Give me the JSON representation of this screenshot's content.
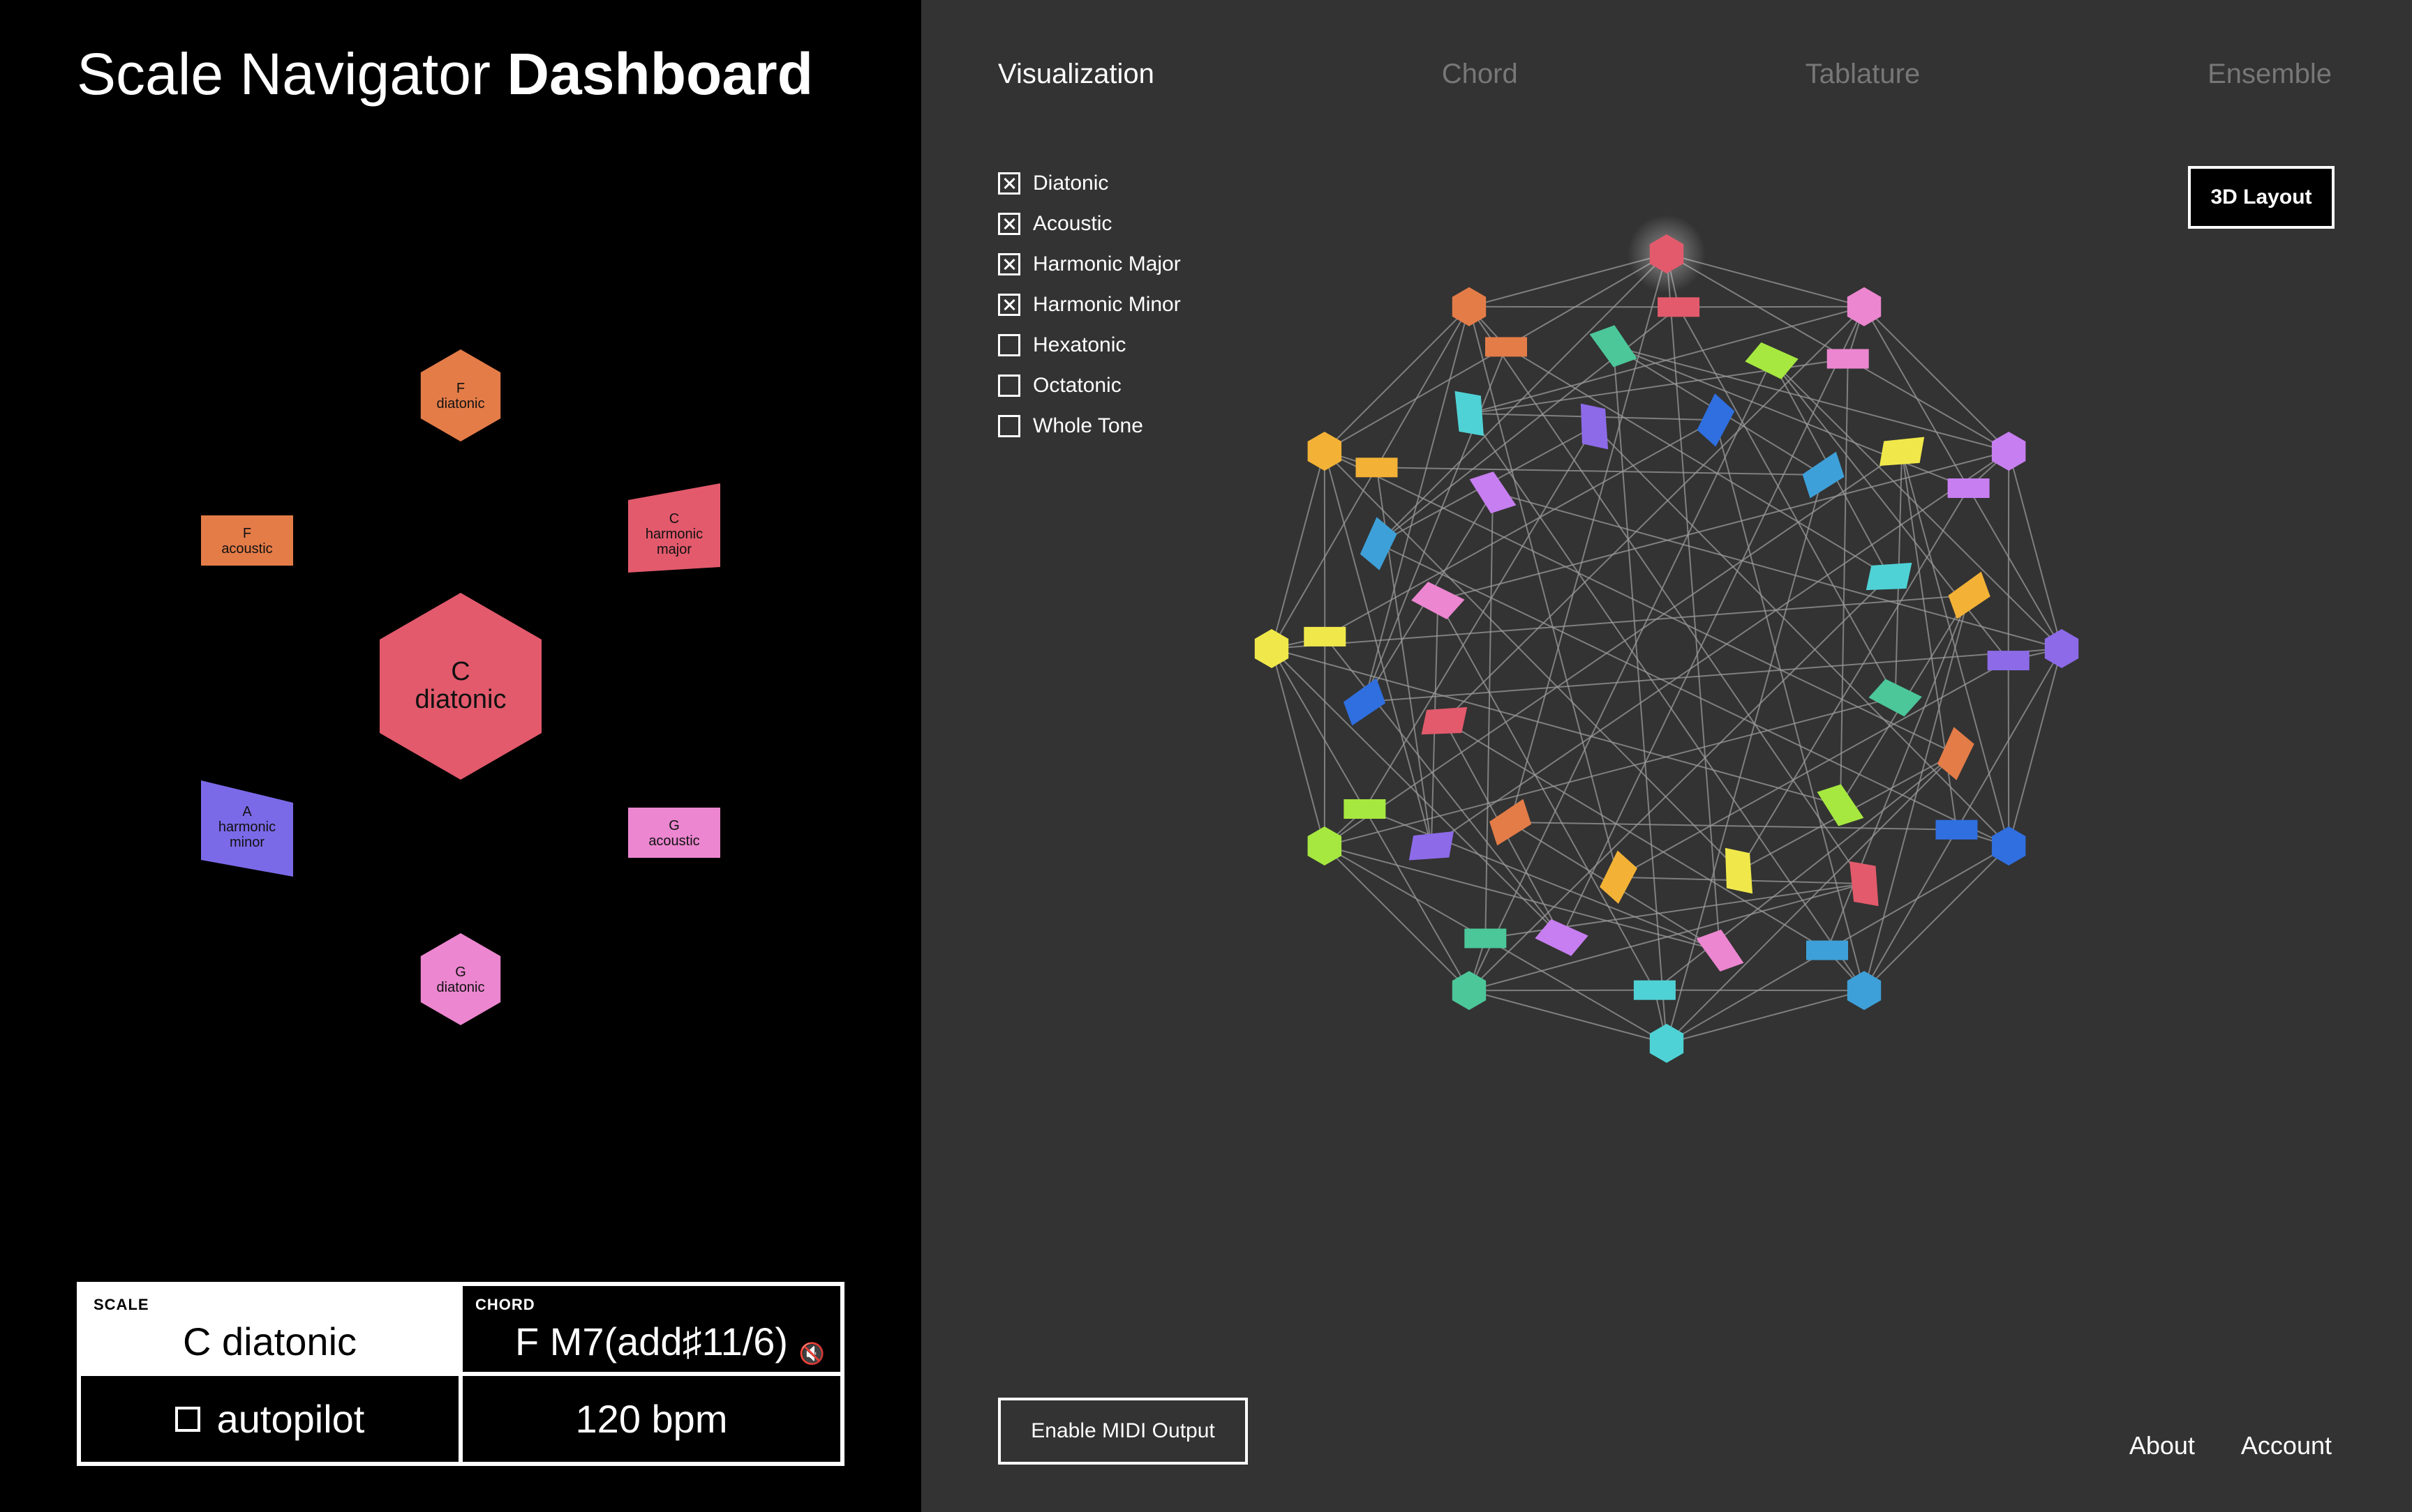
{
  "app": {
    "title_regular": "Scale Navigator",
    "title_bold": "Dashboard"
  },
  "left_graph": {
    "center": {
      "note": "C",
      "type": "diatonic",
      "color": "#e35a6c"
    },
    "nodes": [
      {
        "note": "F",
        "type": "diatonic",
        "color": "#e47c48",
        "shape": "hexagon"
      },
      {
        "note": "F",
        "type": "acoustic",
        "color": "#e47c48",
        "shape": "rectangle"
      },
      {
        "note": "C",
        "type": "harmonic major",
        "color": "#e35a6c",
        "shape": "trapezoid"
      },
      {
        "note": "A",
        "type": "harmonic minor",
        "color": "#7a6ae8",
        "shape": "trapezoid"
      },
      {
        "note": "G",
        "type": "acoustic",
        "color": "#ec86d0",
        "shape": "rectangle"
      },
      {
        "note": "G",
        "type": "diatonic",
        "color": "#ec86d0",
        "shape": "hexagon"
      }
    ]
  },
  "info": {
    "scale_label": "SCALE",
    "scale_value": "C diatonic",
    "chord_label": "CHORD",
    "chord_value": "F M7(add♯11/6)",
    "autopilot_label": "autopilot",
    "tempo": "120 bpm"
  },
  "tabs": [
    {
      "label": "Visualization",
      "active": true
    },
    {
      "label": "Chord",
      "active": false
    },
    {
      "label": "Tablature",
      "active": false
    },
    {
      "label": "Ensemble",
      "active": false
    }
  ],
  "filters": [
    {
      "label": "Diatonic",
      "checked": true
    },
    {
      "label": "Acoustic",
      "checked": true
    },
    {
      "label": "Harmonic Major",
      "checked": true
    },
    {
      "label": "Harmonic Minor",
      "checked": true
    },
    {
      "label": "Hexatonic",
      "checked": false
    },
    {
      "label": "Octatonic",
      "checked": false
    },
    {
      "label": "Whole Tone",
      "checked": false
    }
  ],
  "buttons": {
    "layout_3d": "3D Layout",
    "midi": "Enable MIDI Output"
  },
  "footer": {
    "about": "About",
    "account": "Account"
  },
  "colors": {
    "left_bg": "#000000",
    "right_bg": "#333333",
    "edge": "#9a9a9a",
    "ring_palette": [
      "#e35a6c",
      "#ec86d0",
      "#c77ef0",
      "#8d6ae8",
      "#2f6fe0",
      "#3ea0d8",
      "#4fd2d6",
      "#4cc79a",
      "#a6e840",
      "#f0e84a",
      "#f3b236",
      "#e47c48"
    ]
  }
}
